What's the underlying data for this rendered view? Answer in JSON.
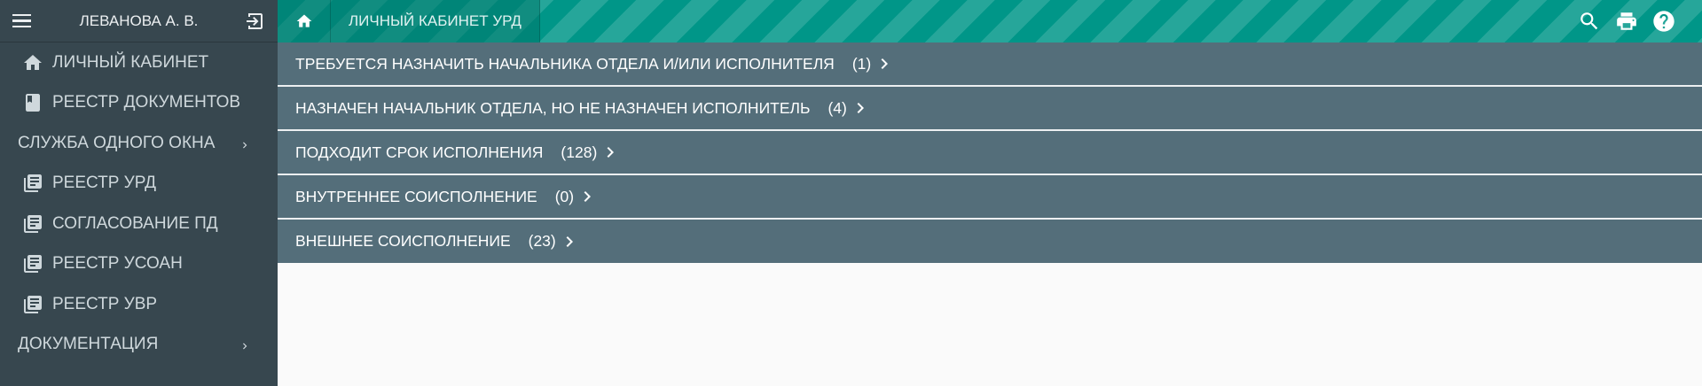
{
  "sidebar": {
    "user_name": "ЛЕВАНОВА А. В.",
    "items": [
      {
        "label": "ЛИЧНЫЙ КАБИНЕТ",
        "icon": "home-icon"
      },
      {
        "label": "РЕЕСТР ДОКУМЕНТОВ",
        "icon": "book-icon"
      },
      {
        "label": "СЛУЖБА ОДНОГО ОКНА",
        "icon": "chevron-right-icon"
      },
      {
        "label": "РЕЕСТР УРД",
        "icon": "library-books-icon"
      },
      {
        "label": "СОГЛАСОВАНИЕ ПД",
        "icon": "library-books-icon"
      },
      {
        "label": "РЕЕСТР УСОАН",
        "icon": "library-books-icon"
      },
      {
        "label": "РЕЕСТР УВР",
        "icon": "library-books-icon"
      },
      {
        "label": "ДОКУМЕНТАЦИЯ",
        "icon": "chevron-right-icon"
      }
    ]
  },
  "topbar": {
    "title": "ЛИЧНЫЙ КАБИНЕТ УРД",
    "tools": [
      "search-icon",
      "print-icon",
      "help-icon"
    ]
  },
  "colors": {
    "sidebar_bg": "#37474f",
    "topbar_teal": "#009688",
    "row_bg": "#546e7a",
    "content_bg": "#fafafa"
  },
  "main": {
    "rows": [
      {
        "label": "ТРЕБУЕТСЯ НАЗНАЧИТЬ НАЧАЛЬНИКА ОТДЕЛА И/ИЛИ ИСПОЛНИТЕЛЯ",
        "count": "(1)"
      },
      {
        "label": "НАЗНАЧЕН НАЧАЛЬНИК ОТДЕЛА, НО НЕ НАЗНАЧЕН ИСПОЛНИТЕЛЬ",
        "count": "(4)"
      },
      {
        "label": "ПОДХОДИТ СРОК ИСПОЛНЕНИЯ",
        "count": "(128)"
      },
      {
        "label": "ВНУТРЕННЕЕ СОИСПОЛНЕНИЕ",
        "count": "(0)"
      },
      {
        "label": "ВНЕШНЕЕ СОИСПОЛНЕНИЕ",
        "count": "(23)"
      }
    ]
  }
}
